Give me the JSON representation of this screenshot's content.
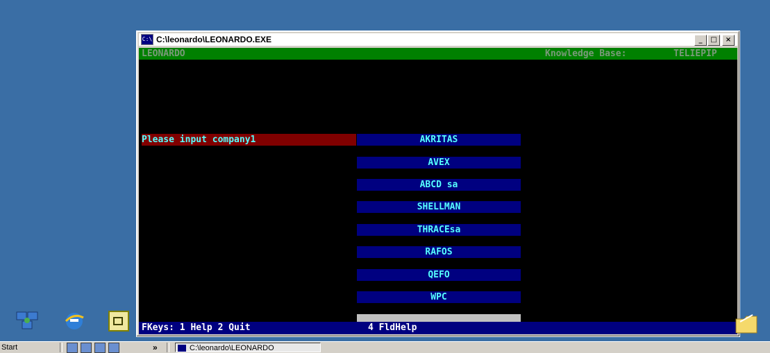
{
  "window": {
    "title": "C:\\leonardo\\LEONARDO.EXE",
    "icon_text": "C:\\",
    "buttons": {
      "minimize": "_",
      "maximize": "□",
      "close": "×"
    }
  },
  "console": {
    "app_name": "LEONARDO",
    "kb_label": "Knowledge Base:",
    "kb_name": "TELIEPIP",
    "prompt": "Please input company1",
    "companies": [
      "AKRITAS",
      "AVEX",
      "ABCD sa",
      "SHELLMAN",
      "THRACEsa",
      "RAFOS",
      "QEFO",
      "WPC"
    ],
    "fkeys_left": "FKeys: 1 Help 2 Quit",
    "fkeys_right": "4 FldHelp"
  },
  "taskbar": {
    "start": "Start",
    "expand": "»",
    "task_label": "C:\\leonardo\\LEONARDO"
  },
  "colors": {
    "desktop": "#3a6ea5",
    "console_bg": "#000000",
    "topbar": "#008000",
    "prompt_bg": "#800000",
    "company_bg": "#000080",
    "text_cyan": "#55ffff"
  },
  "desktop_icons": [
    "network-icon",
    "internet-explorer-icon",
    "shortcut-icon",
    "folder-icon"
  ]
}
